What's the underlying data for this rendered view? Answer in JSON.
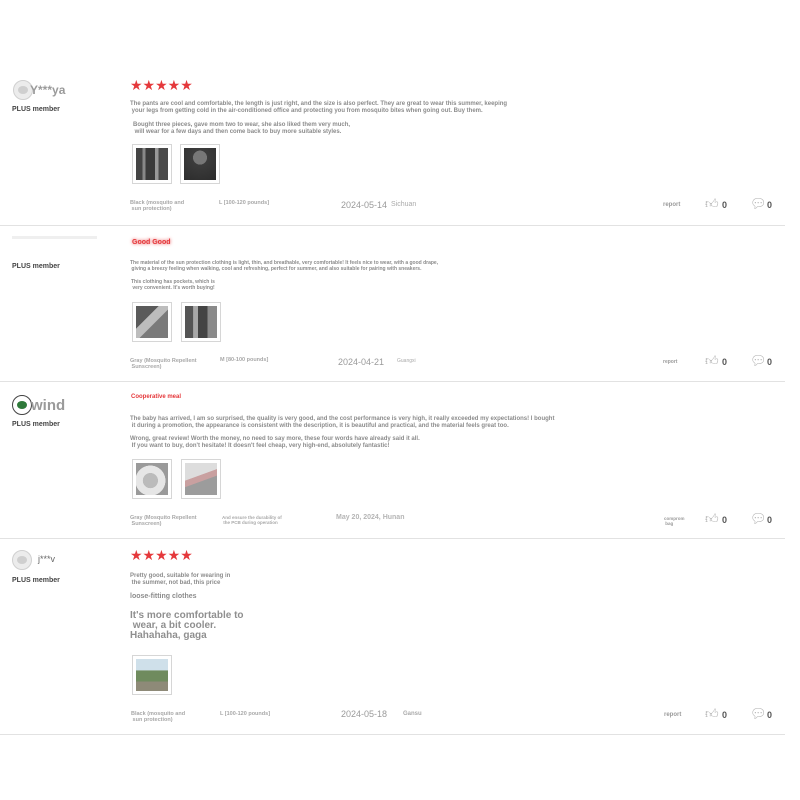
{
  "reviews": [
    {
      "username": "Y***ya",
      "badge": "PLUS member",
      "stars": "★★★★★",
      "text1": "The pants are cool and comfortable, the length is just right, and the size is also perfect. They are great to wear this summer, keeping\n your legs from getting cold in the air-conditioned office and protecting you from mosquito bites when going out. Buy them.",
      "text2": "Bought three pieces, gave mom two to wear, she also liked them very much,\n will wear for a few days and then come back to buy more suitable styles.",
      "color_label": "Black (mosquito and\n sun protection)",
      "size_label": "L [100-120 pounds]",
      "date": "2024-05-14",
      "location": "Sichuan",
      "report": "report",
      "likes": "0",
      "comments": "0"
    },
    {
      "username": "",
      "badge": "PLUS member",
      "tag": "Good  Good",
      "text1": "The material of the sun protection clothing is light, thin, and breathable, very comfortable! It feels nice to wear, with a good drape,\n giving a breezy feeling when walking, cool and refreshing, perfect for summer, and also suitable for pairing with sneakers.",
      "text2": "This clothing has pockets, which is\n very convenient. It's worth buying!",
      "color_label": "Gray (Mosquito Repellent\n Sunscreen)",
      "size_label": "M [80-100 pounds]",
      "date": "2024-04-21",
      "location": "Guangxi",
      "report": "report",
      "likes": "0",
      "comments": "0"
    },
    {
      "username": "wind",
      "badge": "PLUS member",
      "tag": "Cooperative meal",
      "text1": "The baby has arrived, I am so surprised, the quality is very good, and the cost performance is very high, it really exceeded my expectations! I bought\n it during a promotion, the appearance is consistent with the description, it is beautiful and practical, and the material feels great too.",
      "text2": "Wrong, great review! Worth the money, no need to say more, these four words have already said it all.\n If you want to buy, don't hesitate! It doesn't feel cheap, very high-end, absolutely fantastic!",
      "color_label": "Gray (Mosquito Repellent\n Sunscreen)",
      "size_label": "And ensure the durability of\n the PCB during operation",
      "date": "May 20, 2024, Hunan",
      "location": "",
      "report": "comprom\n bag",
      "likes": "0",
      "comments": "0"
    },
    {
      "username": "j***v",
      "badge": "PLUS member",
      "stars": "★★★★★",
      "text1": "Pretty good, suitable for wearing in\n the summer, not bad, this price",
      "text2": "loose-fitting clothes",
      "big_text": "It's more comfortable to\n wear, a bit cooler.\nHahahaha, gaga",
      "color_label": "Black (mosquito and\n sun protection)",
      "size_label": "L [100-120 pounds]",
      "date": "2024-05-18",
      "location": "Gansu",
      "report": "report",
      "likes": "0",
      "comments": "0"
    }
  ],
  "icons": {
    "like": "thumbs-up-icon",
    "comment": "comment-icon"
  },
  "colors": {
    "star": "#e5383b",
    "divider": "#e2e2e2",
    "text": "#8c8c8c"
  }
}
